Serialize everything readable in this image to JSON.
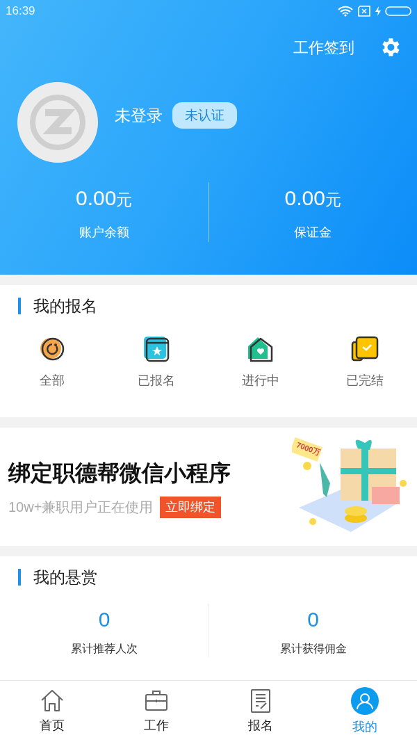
{
  "status_bar": {
    "time": "16:39"
  },
  "header": {
    "checkin": "工作签到",
    "name": "未登录",
    "badge": "未认证",
    "balances": [
      {
        "amount": "0.00",
        "unit": "元",
        "label": "账户余额"
      },
      {
        "amount": "0.00",
        "unit": "元",
        "label": "保证金"
      }
    ]
  },
  "signups": {
    "title": "我的报名",
    "items": [
      {
        "kind": "all",
        "label": "全部"
      },
      {
        "kind": "registered",
        "label": "已报名"
      },
      {
        "kind": "ongoing",
        "label": "进行中"
      },
      {
        "kind": "done",
        "label": "已完结"
      }
    ]
  },
  "banner": {
    "title": "绑定职德帮微信小程序",
    "subtitle": "10w+兼职用户正在使用",
    "button": "立即绑定",
    "sign": "7000万"
  },
  "rewards": {
    "title": "我的悬赏",
    "stats": [
      {
        "value": "0",
        "label": "累计推荐人次"
      },
      {
        "value": "0",
        "label": "累计获得佣金"
      }
    ]
  },
  "nav": [
    {
      "kind": "home",
      "label": "首页",
      "selected": false
    },
    {
      "kind": "work",
      "label": "工作",
      "selected": false
    },
    {
      "kind": "signup",
      "label": "报名",
      "selected": false
    },
    {
      "kind": "me",
      "label": "我的",
      "selected": true
    }
  ]
}
